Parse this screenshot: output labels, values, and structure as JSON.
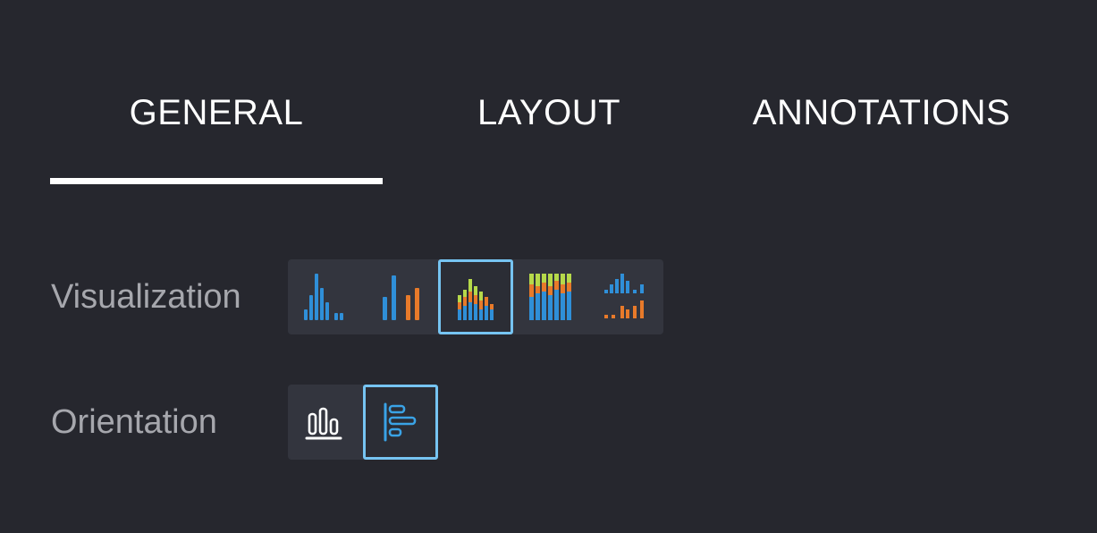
{
  "tabs": {
    "general": "GENERAL",
    "layout": "LAYOUT",
    "annotations": "ANNOTATIONS",
    "active": "general"
  },
  "visualization": {
    "label": "Visualization",
    "options": [
      {
        "icon": "grouped-bars-blue-icon",
        "selected": false
      },
      {
        "icon": "split-bars-blue-orange-icon",
        "selected": false
      },
      {
        "icon": "stacked-bars-multicolor-icon",
        "selected": true
      },
      {
        "icon": "stacked-percent-bars-icon",
        "selected": false
      },
      {
        "icon": "small-multiples-bars-icon",
        "selected": false
      }
    ]
  },
  "orientation": {
    "label": "Orientation",
    "options": [
      {
        "icon": "vertical-bars-icon",
        "selected": false
      },
      {
        "icon": "horizontal-bars-icon",
        "selected": true
      }
    ]
  },
  "colors": {
    "background": "#26272e",
    "selected_border": "#76c4f2",
    "blue": "#2f8fd8",
    "orange": "#e87a2a",
    "green_yellow": "#b6d94a",
    "label_gray": "#a6a7ad"
  }
}
